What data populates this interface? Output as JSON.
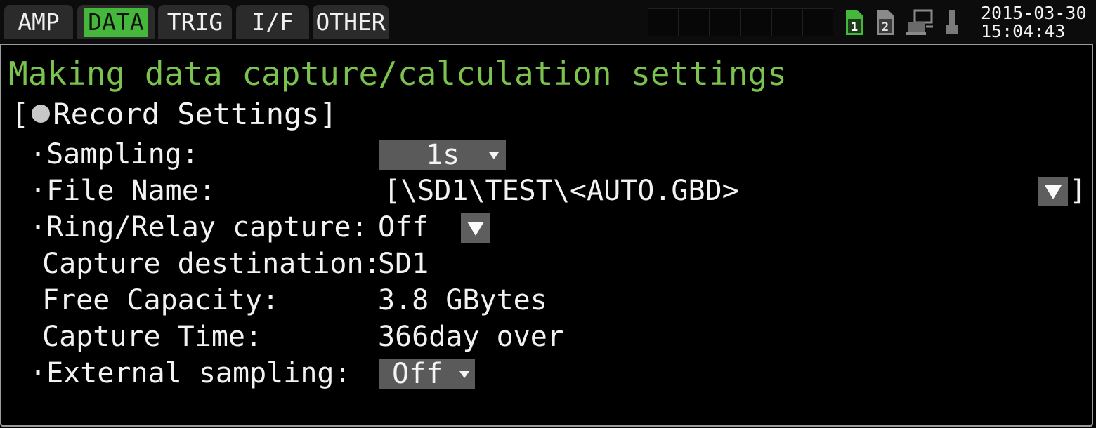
{
  "tabs": [
    {
      "label": "AMP"
    },
    {
      "label": "DATA"
    },
    {
      "label": "TRIG"
    },
    {
      "label": "I/F"
    },
    {
      "label": "OTHER"
    }
  ],
  "status": {
    "date": "2015-03-30",
    "time": "15:04:43",
    "icons": [
      "sd1-icon",
      "sd2-icon",
      "pc-connection-icon",
      "usb-icon"
    ],
    "accent": "#45b83c"
  },
  "title": "Making data capture/calculation settings",
  "section": {
    "prefix": "[",
    "label": "Record Settings]"
  },
  "settings": {
    "sampling": {
      "label": "·Sampling:",
      "value": "1s"
    },
    "file_name": {
      "label": "·File Name:",
      "value": "[\\SD1\\TEST\\<AUTO.GBD>",
      "end": "]"
    },
    "ring_relay": {
      "label": "·Ring/Relay capture:",
      "value": "Off"
    },
    "capture_destination": {
      "label": "Capture destination:",
      "value": "SD1"
    },
    "free_capacity": {
      "label": "Free Capacity:",
      "value": "3.8 GBytes"
    },
    "capture_time": {
      "label": "Capture Time:",
      "value": "366day over"
    },
    "external_sampling": {
      "label": "·External sampling:",
      "value": "Off"
    }
  },
  "colors": {
    "title": "#7bc24e",
    "background": "#000000",
    "dropdown": "#5a5a5a"
  }
}
